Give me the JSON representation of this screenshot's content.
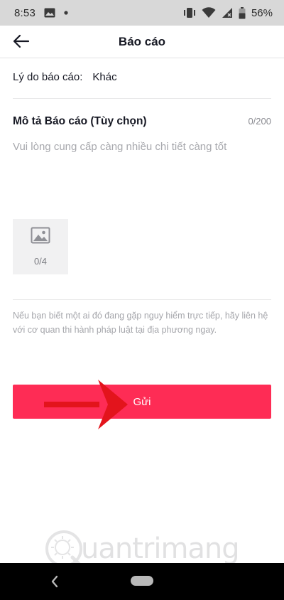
{
  "status_bar": {
    "time": "8:53",
    "battery": "56%",
    "icons": [
      "image-icon",
      "dot-icon",
      "vibrate-icon",
      "wifi-icon",
      "no-sim-icon",
      "battery-icon"
    ]
  },
  "header": {
    "title": "Báo cáo",
    "back_icon": "arrow-left-icon"
  },
  "reason": {
    "label": "Lý do báo cáo:",
    "value": "Khác"
  },
  "description": {
    "title": "Mô tả Báo cáo (Tùy chọn)",
    "counter": "0/200",
    "placeholder": "Vui lòng cung cấp càng nhiều chi tiết càng tốt",
    "value": ""
  },
  "upload": {
    "icon": "image-placeholder-icon",
    "counter": "0/4"
  },
  "notice": "Nếu bạn biết một ai đó đang gặp nguy hiểm trực tiếp, hãy liên hệ với cơ quan thi hành pháp luật tại địa phương ngay.",
  "submit": {
    "label": "Gửi"
  },
  "watermark": {
    "text": "uantrimang"
  },
  "colors": {
    "accent": "#fe2c55",
    "annotation_arrow": "#e3141c",
    "status_bar_bg": "#d8d8d8",
    "nav_bar_bg": "#000000"
  }
}
